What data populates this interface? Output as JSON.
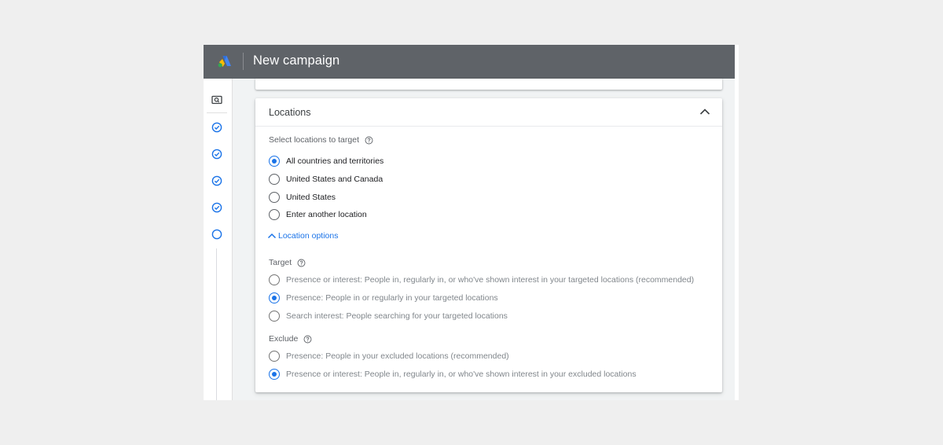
{
  "header": {
    "title": "New campaign",
    "logo_icon": "google-ads-logo"
  },
  "sidebar": {
    "icons": [
      "search-overview-icon",
      "check-circle-icon",
      "check-circle-icon",
      "check-circle-icon",
      "check-circle-icon",
      "empty-circle-icon"
    ]
  },
  "locations": {
    "title": "Locations",
    "select_label": "Select locations to target",
    "options": [
      {
        "label": "All countries and territories",
        "selected": true
      },
      {
        "label": "United States and Canada",
        "selected": false
      },
      {
        "label": "United States",
        "selected": false
      },
      {
        "label": "Enter another location",
        "selected": false
      }
    ],
    "location_options_label": "Location options",
    "target": {
      "label": "Target",
      "options": [
        {
          "label": "Presence or interest: People in, regularly in, or who've shown interest in your targeted locations (recommended)",
          "selected": false
        },
        {
          "label": "Presence: People in or regularly in your targeted locations",
          "selected": true
        },
        {
          "label": "Search interest: People searching for your targeted locations",
          "selected": false
        }
      ]
    },
    "exclude": {
      "label": "Exclude",
      "options": [
        {
          "label": "Presence: People in your excluded locations (recommended)",
          "selected": false
        },
        {
          "label": "Presence or interest: People in, regularly in, or who've shown interest in your excluded locations",
          "selected": true
        }
      ]
    }
  },
  "colors": {
    "accent": "#1a73e8",
    "topbar": "#5f6368",
    "logo_blue": "#4285f4",
    "logo_yellow": "#fbbc04",
    "logo_green": "#34a853"
  }
}
